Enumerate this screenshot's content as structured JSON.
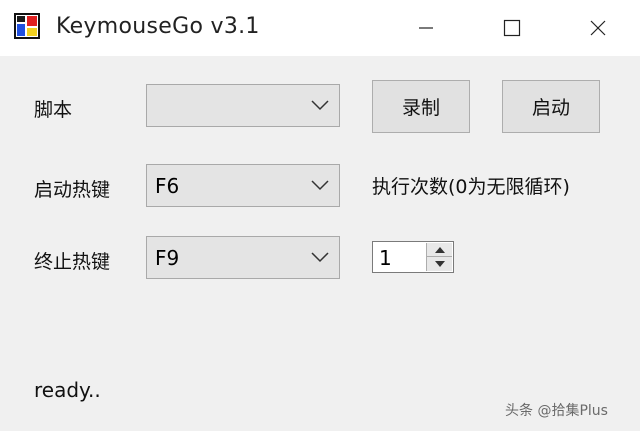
{
  "window": {
    "title": "KeymouseGo v3.1"
  },
  "form": {
    "script_label": "脚本",
    "script_value": "",
    "record_button": "录制",
    "start_button": "启动",
    "start_hotkey_label": "启动热键",
    "start_hotkey_value": "F6",
    "stop_hotkey_label": "终止热键",
    "stop_hotkey_value": "F9",
    "exec_count_label": "执行次数(0为无限循环)",
    "exec_count_value": "1"
  },
  "status": {
    "text": "ready.."
  },
  "watermark": {
    "text": "头条 @拾集Plus"
  }
}
